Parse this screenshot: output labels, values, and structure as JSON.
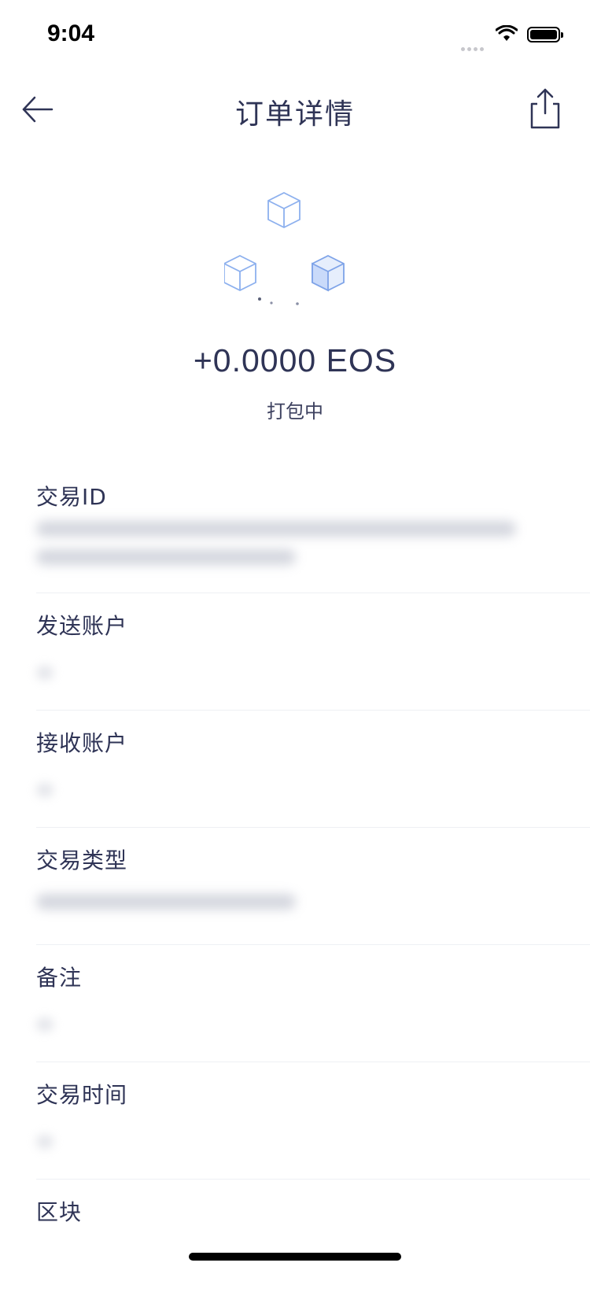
{
  "status_bar": {
    "time": "9:04"
  },
  "nav": {
    "title": "订单详情"
  },
  "hero": {
    "amount": "+0.0000 EOS",
    "status": "打包中"
  },
  "details": {
    "items": [
      {
        "label": "交易ID"
      },
      {
        "label": "发送账户"
      },
      {
        "label": "接收账户"
      },
      {
        "label": "交易类型"
      },
      {
        "label": "备注"
      },
      {
        "label": "交易时间"
      },
      {
        "label": "区块"
      }
    ]
  },
  "icons": [
    "back-arrow-icon",
    "share-icon",
    "cube-icon",
    "wifi-icon",
    "battery-icon"
  ],
  "colors": {
    "text": "#2f3456",
    "cube_stroke": "#7ea3e8",
    "cube_fill": "#dbe6fb"
  }
}
